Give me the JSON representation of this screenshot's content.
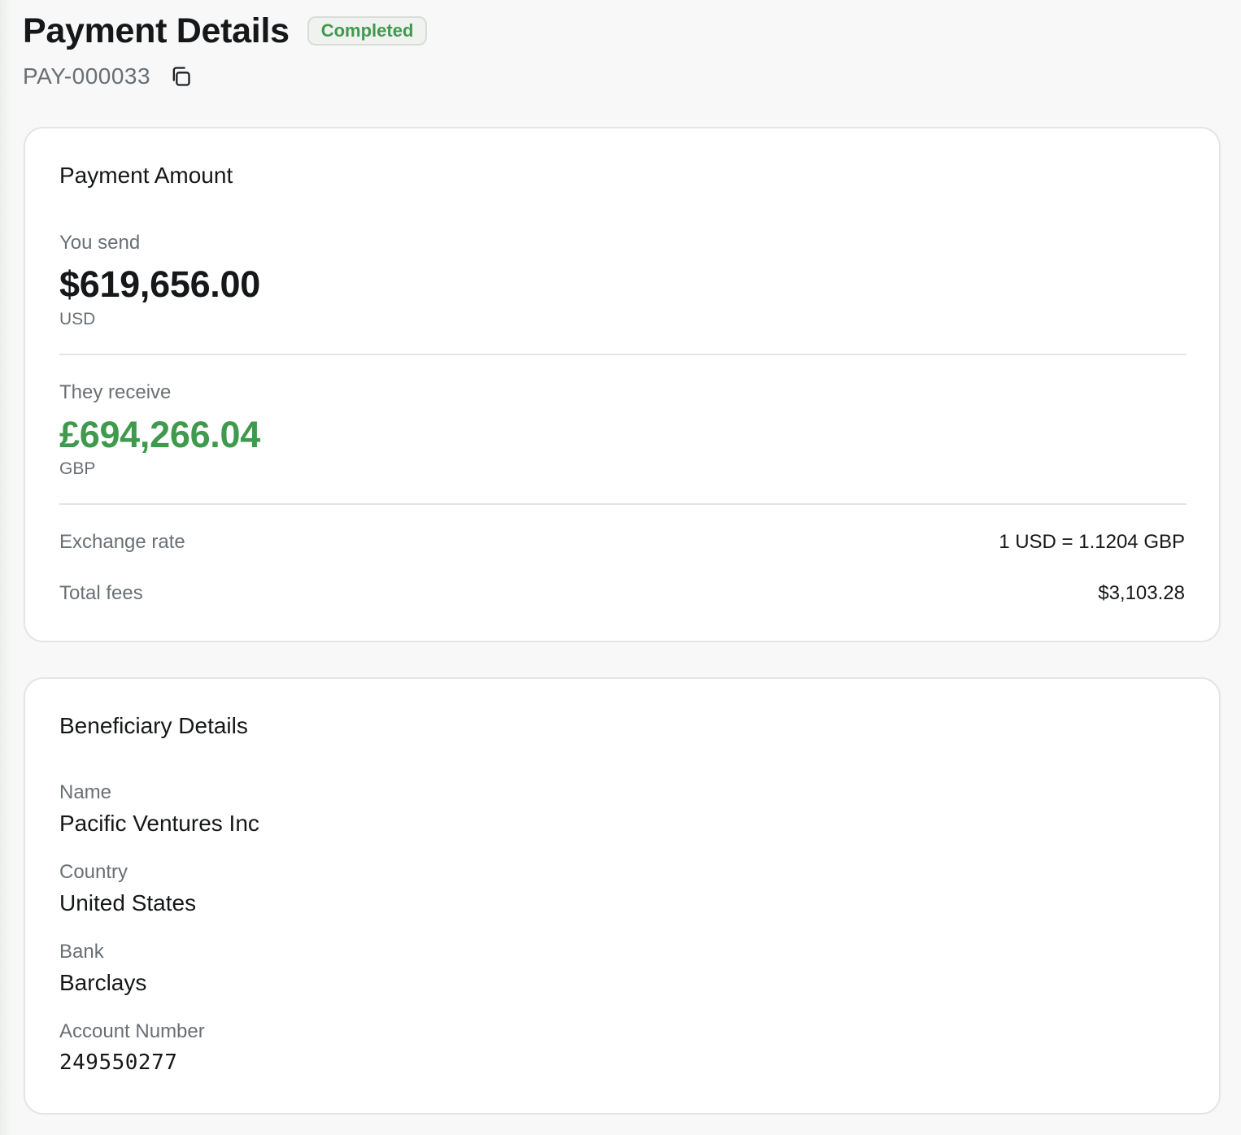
{
  "header": {
    "title": "Payment Details",
    "status": "Completed",
    "payment_id": "PAY-000033",
    "copy_icon": "copy-icon"
  },
  "payment_amount": {
    "title": "Payment Amount",
    "send_label": "You send",
    "send_amount": "$619,656.00",
    "send_currency": "USD",
    "receive_label": "They receive",
    "receive_amount": "£694,266.04",
    "receive_currency": "GBP",
    "exchange_rate_label": "Exchange rate",
    "exchange_rate_value": "1 USD = 1.1204 GBP",
    "fees_label": "Total fees",
    "fees_value": "$3,103.28"
  },
  "beneficiary": {
    "title": "Beneficiary Details",
    "name_label": "Name",
    "name_value": "Pacific Ventures Inc",
    "country_label": "Country",
    "country_value": "United States",
    "bank_label": "Bank",
    "bank_value": "Barclays",
    "account_label": "Account Number",
    "account_value": "249550277"
  },
  "colors": {
    "success_green": "#3f9a4d",
    "muted_text": "#6a6f74",
    "primary_text": "#151719",
    "page_background": "#f7f8f7"
  }
}
